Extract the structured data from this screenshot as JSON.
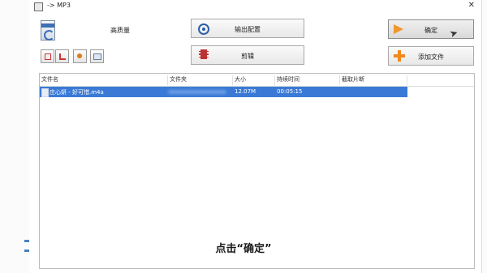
{
  "window": {
    "title": "-> MP3"
  },
  "header": {
    "quality_label": "高质量"
  },
  "buttons": {
    "output_config": "输出配置",
    "edit": "剪辑",
    "ok": "确定",
    "add_file": "添加文件"
  },
  "table": {
    "columns": [
      "文件名",
      "文件夹",
      "大小",
      "持续时间",
      "截取片断"
    ],
    "rows": [
      {
        "filename": "庄心妍 - 好可惜.m4a",
        "folder": "",
        "size": "12.07M",
        "duration": "00:05:15",
        "clip": ""
      }
    ],
    "selected_row": 0
  },
  "caption": "点击“确定”",
  "colors": {
    "selection": "#3a7ad6",
    "accent_orange": "#f0962c",
    "accent_blue": "#2b5ea8"
  }
}
